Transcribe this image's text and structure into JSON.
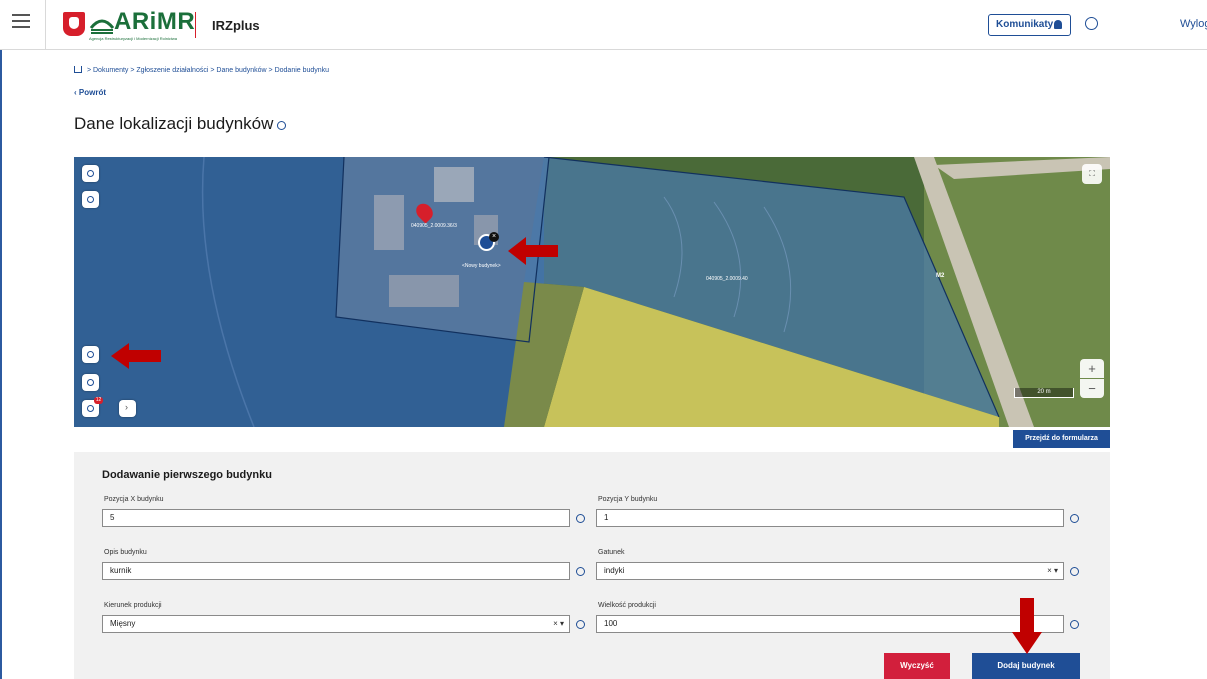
{
  "header": {
    "logo_text": "ARiMR",
    "logo_subtext": "Agencja Restrukturyzacji i Modernizacji Rolnictwa",
    "app_name": "IRZplus",
    "notifications_label": "Komunikaty",
    "logout_label": "Wyloguj"
  },
  "breadcrumb": {
    "items": [
      "Dokumenty",
      "Zgłoszenie działalności",
      "Dane budynków",
      "Dodanie budynku"
    ],
    "separator": ">"
  },
  "back_label": "Powrót",
  "page_title": "Dane lokalizacji budynków",
  "map": {
    "parcel_label_1": "040905_2.0009.36/3",
    "parcel_label_2": "040905_2.0009.40",
    "new_building_label": "<Nowy budynek>",
    "road_label": "M2",
    "scale_label": "20 m",
    "layers_badge": "12",
    "zoom_in_label": "+",
    "zoom_out_label": "−",
    "fullscreen_label": "⛶",
    "goto_form_label": "Przejdź do formularza"
  },
  "form": {
    "title": "Dodawanie pierwszego budynku",
    "pos_x_label": "Pozycja X budynku",
    "pos_x_value": "5",
    "pos_y_label": "Pozycja Y budynku",
    "pos_y_value": "1",
    "description_label": "Opis budynku",
    "description_value": "kurnik",
    "species_label": "Gatunek",
    "species_value": "indyki",
    "direction_label": "Kierunek produkcji",
    "direction_value": "Mięsny",
    "size_label": "Wielkość produkcji",
    "size_value": "100",
    "clear_label": "Wyczyść",
    "add_label": "Dodaj budynek"
  },
  "colors": {
    "primary": "#1f4e96",
    "danger": "#d21f3c",
    "brand_green": "#1b6f3a",
    "arrow_red": "#c00000"
  }
}
